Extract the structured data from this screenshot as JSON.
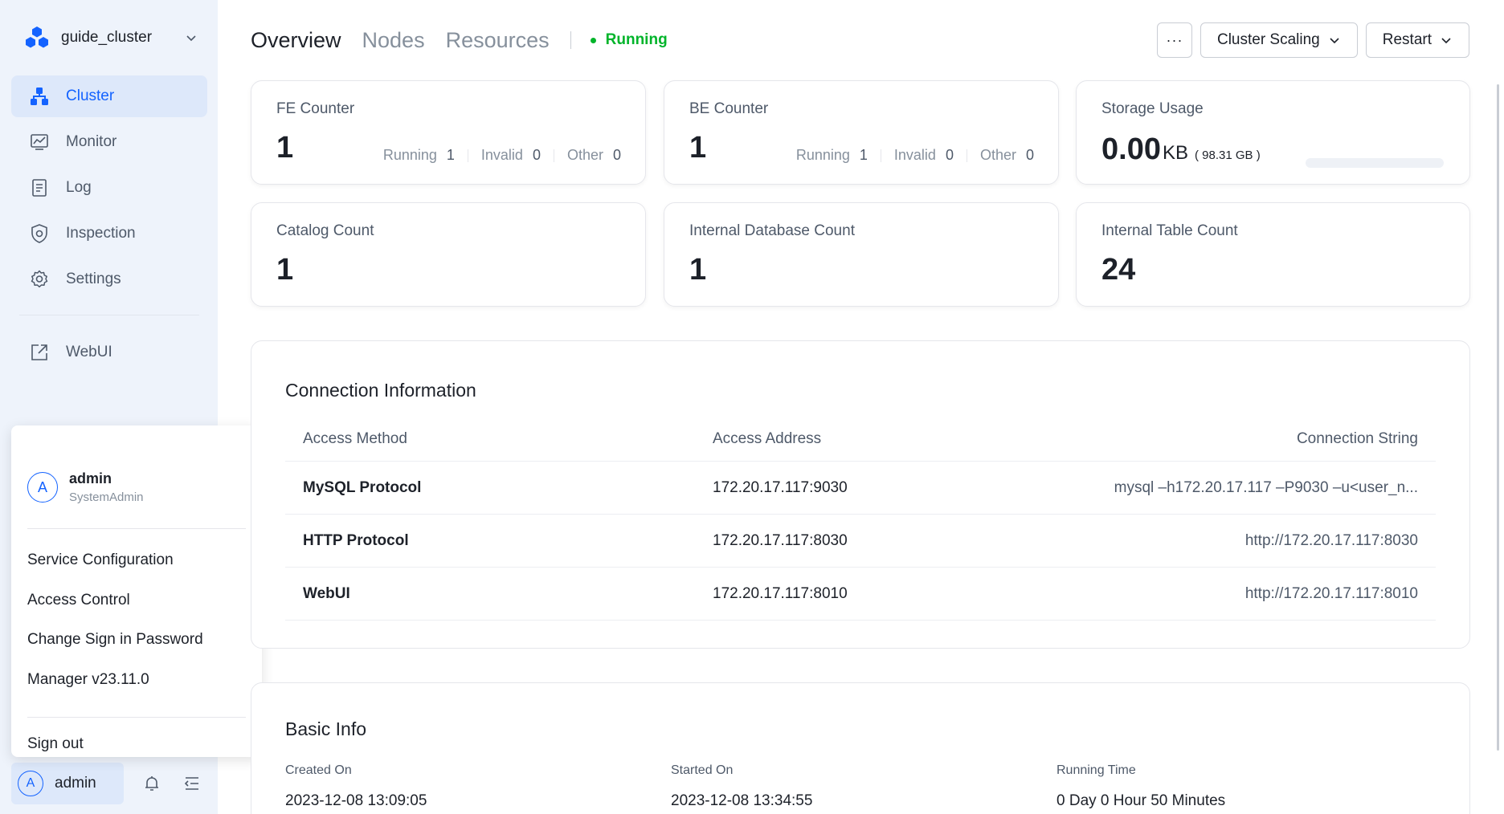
{
  "sidebar": {
    "cluster_name": "guide_cluster",
    "nav": [
      {
        "label": "Cluster",
        "icon": "cluster-icon",
        "active": true
      },
      {
        "label": "Monitor",
        "icon": "monitor-icon"
      },
      {
        "label": "Log",
        "icon": "log-icon"
      },
      {
        "label": "Inspection",
        "icon": "shield-icon"
      },
      {
        "label": "Settings",
        "icon": "gear-icon"
      }
    ],
    "webui": {
      "label": "WebUI",
      "icon": "external-link-icon"
    }
  },
  "user_menu": {
    "avatar_initial": "A",
    "username": "admin",
    "role": "SystemAdmin",
    "items": [
      "Service Configuration",
      "Access Control",
      "Change Sign in Password",
      "Manager v23.11.0"
    ],
    "sign_out": "Sign out"
  },
  "bottombar": {
    "avatar_initial": "A",
    "username": "admin"
  },
  "header": {
    "tabs": [
      "Overview",
      "Nodes",
      "Resources"
    ],
    "status": "Running",
    "more_label": "···",
    "scaling_label": "Cluster Scaling",
    "restart_label": "Restart"
  },
  "cards": {
    "fe": {
      "title": "FE Counter",
      "value": "1",
      "running_label": "Running",
      "running": "1",
      "invalid_label": "Invalid",
      "invalid": "0",
      "other_label": "Other",
      "other": "0"
    },
    "be": {
      "title": "BE Counter",
      "value": "1",
      "running_label": "Running",
      "running": "1",
      "invalid_label": "Invalid",
      "invalid": "0",
      "other_label": "Other",
      "other": "0"
    },
    "storage": {
      "title": "Storage Usage",
      "value": "0.00",
      "unit": "KB",
      "total": "( 98.31 GB )",
      "usage_fraction": 0.0
    },
    "catalog": {
      "title": "Catalog Count",
      "value": "1"
    },
    "database": {
      "title": "Internal Database Count",
      "value": "1"
    },
    "table": {
      "title": "Internal Table Count",
      "value": "24"
    }
  },
  "connection": {
    "title": "Connection Information",
    "columns": [
      "Access Method",
      "Access Address",
      "Connection String"
    ],
    "rows": [
      {
        "method": "MySQL Protocol",
        "address": "172.20.17.117:9030",
        "conn": "mysql –h172.20.17.117 –P9030 –u<user_n..."
      },
      {
        "method": "HTTP Protocol",
        "address": "172.20.17.117:8030",
        "conn": "http://172.20.17.117:8030"
      },
      {
        "method": "WebUI",
        "address": "172.20.17.117:8010",
        "conn": "http://172.20.17.117:8010"
      }
    ]
  },
  "basic_info": {
    "title": "Basic Info",
    "created_label": "Created On",
    "created": "2023-12-08 13:09:05",
    "started_label": "Started On",
    "started": "2023-12-08 13:34:55",
    "running_label": "Running Time",
    "running": "0 Day 0 Hour 50 Minutes"
  },
  "colors": {
    "accent": "#1463ff",
    "status_green": "#00b42a",
    "sidebar_bg": "#eef3fb"
  }
}
